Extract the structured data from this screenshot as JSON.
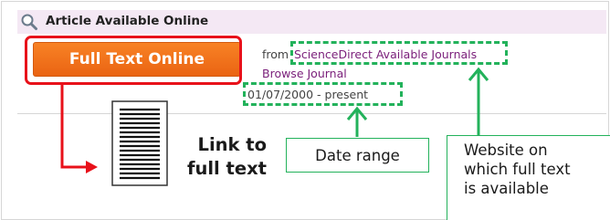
{
  "panel": {
    "header_title": "Article Available Online",
    "header_icon": "search-icon"
  },
  "result": {
    "full_text_button_label": "Full Text Online",
    "from_label": "from",
    "source_link": "ScienceDirect Available Journals",
    "browse_link": "Browse Journal",
    "date_range": "01/07/2000 - present"
  },
  "annotations": {
    "link_to_full_text": [
      "Link to",
      "full text"
    ],
    "date_range_callout": "Date range",
    "website_callout": [
      "Website on",
      "which full text",
      "is available"
    ]
  },
  "colors": {
    "button_orange": "#f07020",
    "highlight_red": "#e8111a",
    "highlight_green": "#23b25b",
    "link_purple": "#7a1f7a",
    "header_bg": "#f4e8f4"
  }
}
